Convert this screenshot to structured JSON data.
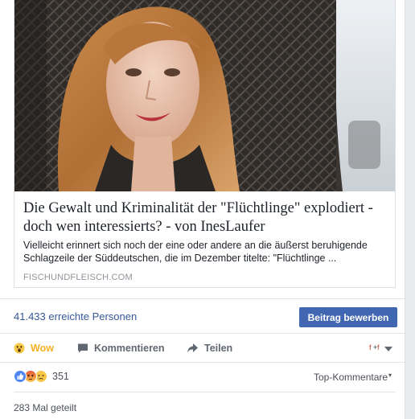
{
  "post": {
    "link_title": "Die Gewalt und Kriminalität der \"Flüchtlinge\" explodiert - doch wen interessierts? - von InesLaufer",
    "link_description": "Vielleicht erinnert sich noch der eine oder andere an die äußerst beruhigende Schlagzeile der Süddeutschen, die im Dezember titelte: \"Flüchtlinge ...",
    "link_domain": "FISCHUNDFLEISCH.COM"
  },
  "stats": {
    "reach_count": "41.433",
    "reach_label": "erreichte Personen",
    "boost_label": "Beitrag bewerben"
  },
  "actions": {
    "wow_label": "Wow",
    "comment_label": "Kommentieren",
    "share_label": "Teilen"
  },
  "reactions": {
    "count": "351",
    "icons": [
      "like-icon",
      "angry-icon",
      "sad-icon"
    ],
    "sort_label": "Top-Kommentare"
  },
  "shares": {
    "label": "283 Mal geteilt"
  },
  "colors": {
    "link_blue": "#365899",
    "button_blue": "#4267b2",
    "wow_yellow": "#f7b125",
    "text_gray": "#616770"
  }
}
